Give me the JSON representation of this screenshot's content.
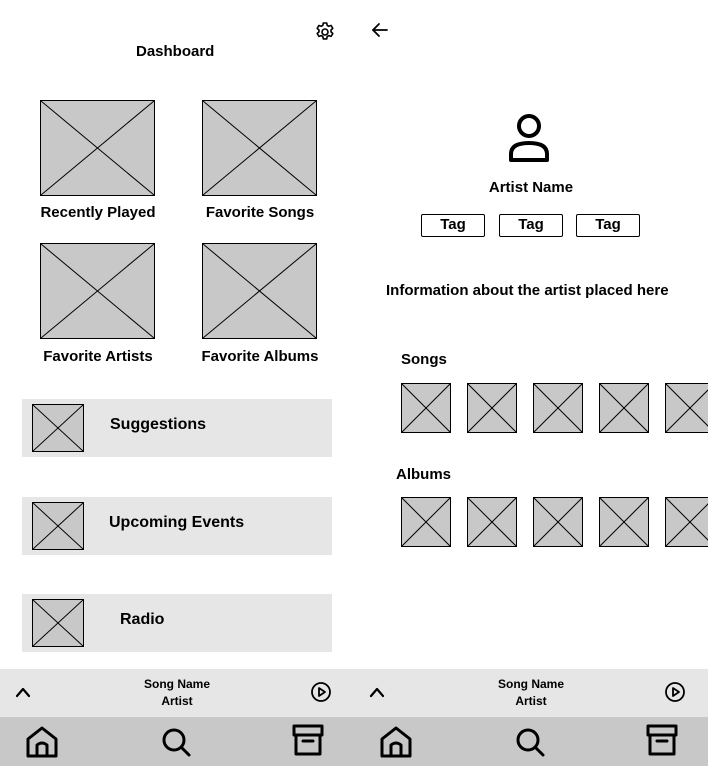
{
  "dashboard": {
    "title": "Dashboard",
    "tiles": [
      {
        "label": "Recently Played"
      },
      {
        "label": "Favorite Songs"
      },
      {
        "label": "Favorite Artists"
      },
      {
        "label": "Favorite Albums"
      }
    ],
    "list": [
      {
        "label": "Suggestions"
      },
      {
        "label": "Upcoming Events"
      },
      {
        "label": "Radio"
      }
    ],
    "settings_icon": "gear-icon"
  },
  "artist": {
    "back_icon": "arrow-left-icon",
    "avatar_icon": "user-icon",
    "name": "Artist Name",
    "tags": [
      "Tag",
      "Tag",
      "Tag"
    ],
    "info": "Information about the artist placed here",
    "songs_heading": "Songs",
    "albums_heading": "Albums"
  },
  "player": {
    "song_name": "Song Name",
    "artist": "Artist",
    "expand_icon": "chevron-up-icon",
    "play_icon": "play-circle-icon"
  },
  "nav": {
    "items": [
      {
        "icon": "home-icon"
      },
      {
        "icon": "search-icon"
      },
      {
        "icon": "archive-icon"
      }
    ]
  },
  "colors": {
    "placeholder": "#c8c8c8",
    "panel": "#e6e6e6",
    "nav_bg": "#c8c8c8"
  }
}
